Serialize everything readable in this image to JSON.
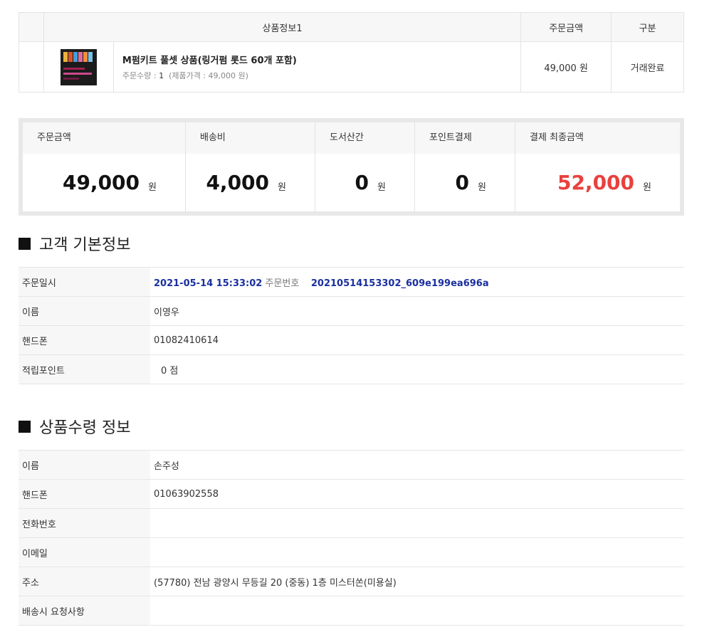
{
  "product_table": {
    "headers": {
      "info": "상품정보1",
      "price": "주문금액",
      "status": "구분"
    },
    "item": {
      "name": "M펌키트 풀셋 상품(링거펌 롯드 60개 포함)",
      "qty_label": "주문수량 : ",
      "qty": "1",
      "unit_price_text": "(제품가격 : 49,000 원)",
      "price": "49,000 원",
      "status": "거래완료"
    }
  },
  "totals": [
    {
      "label": "주문금액",
      "value": "49,000",
      "unit": "원"
    },
    {
      "label": "배송비",
      "value": "4,000",
      "unit": "원"
    },
    {
      "label": "도서산간",
      "value": "0",
      "unit": "원"
    },
    {
      "label": "포인트결제",
      "value": "0",
      "unit": "원"
    },
    {
      "label": "결제 최종금액",
      "value": "52,000",
      "unit": "원"
    }
  ],
  "customer": {
    "title": "고객 기본정보",
    "order_datetime_label": "주문일시",
    "order_datetime": "2021-05-14 15:33:02",
    "order_no_label": "주문번호",
    "order_no": "20210514153302_609e199ea696a",
    "name_label": "이름",
    "name": "이영우",
    "phone_label": "핸드폰",
    "phone": "01082410614",
    "points_label": "적립포인트",
    "points": "0 점"
  },
  "shipping": {
    "title": "상품수령 정보",
    "name_label": "이름",
    "name": "손주성",
    "phone_label": "핸드폰",
    "phone": "01063902558",
    "tel_label": "전화번호",
    "tel": "",
    "email_label": "이메일",
    "email": "",
    "address_label": "주소",
    "address": "(57780) 전남 광양시 무등길 20 (중동) 1층 미스터쏜(미용실)",
    "request_label": "배송시 요청사항",
    "request": ""
  },
  "colors": {
    "accent_red": "#e8413e",
    "link_blue": "#1a2f9f"
  }
}
